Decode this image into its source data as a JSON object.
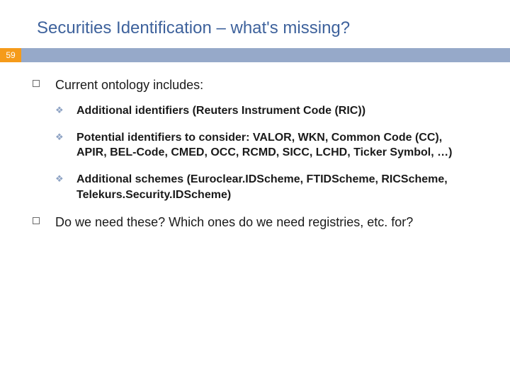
{
  "slide": {
    "title": "Securities Identification – what's missing?",
    "number": "59",
    "items": [
      {
        "text": "Current ontology includes:",
        "sub": [
          {
            "text": "Additional identifiers (Reuters Instrument Code (RIC))"
          },
          {
            "text": "Potential identifiers to consider: VALOR, WKN, Common Code (CC), APIR, BEL-Code, CMED, OCC, RCMD, SICC, LCHD, Ticker Symbol, …)"
          },
          {
            "text": "Additional schemes (Euroclear.IDScheme, FTIDScheme, RICScheme, Telekurs.Security.IDScheme)"
          }
        ]
      },
      {
        "text": "Do we need these?  Which ones do we need registries, etc. for?",
        "sub": []
      }
    ]
  }
}
